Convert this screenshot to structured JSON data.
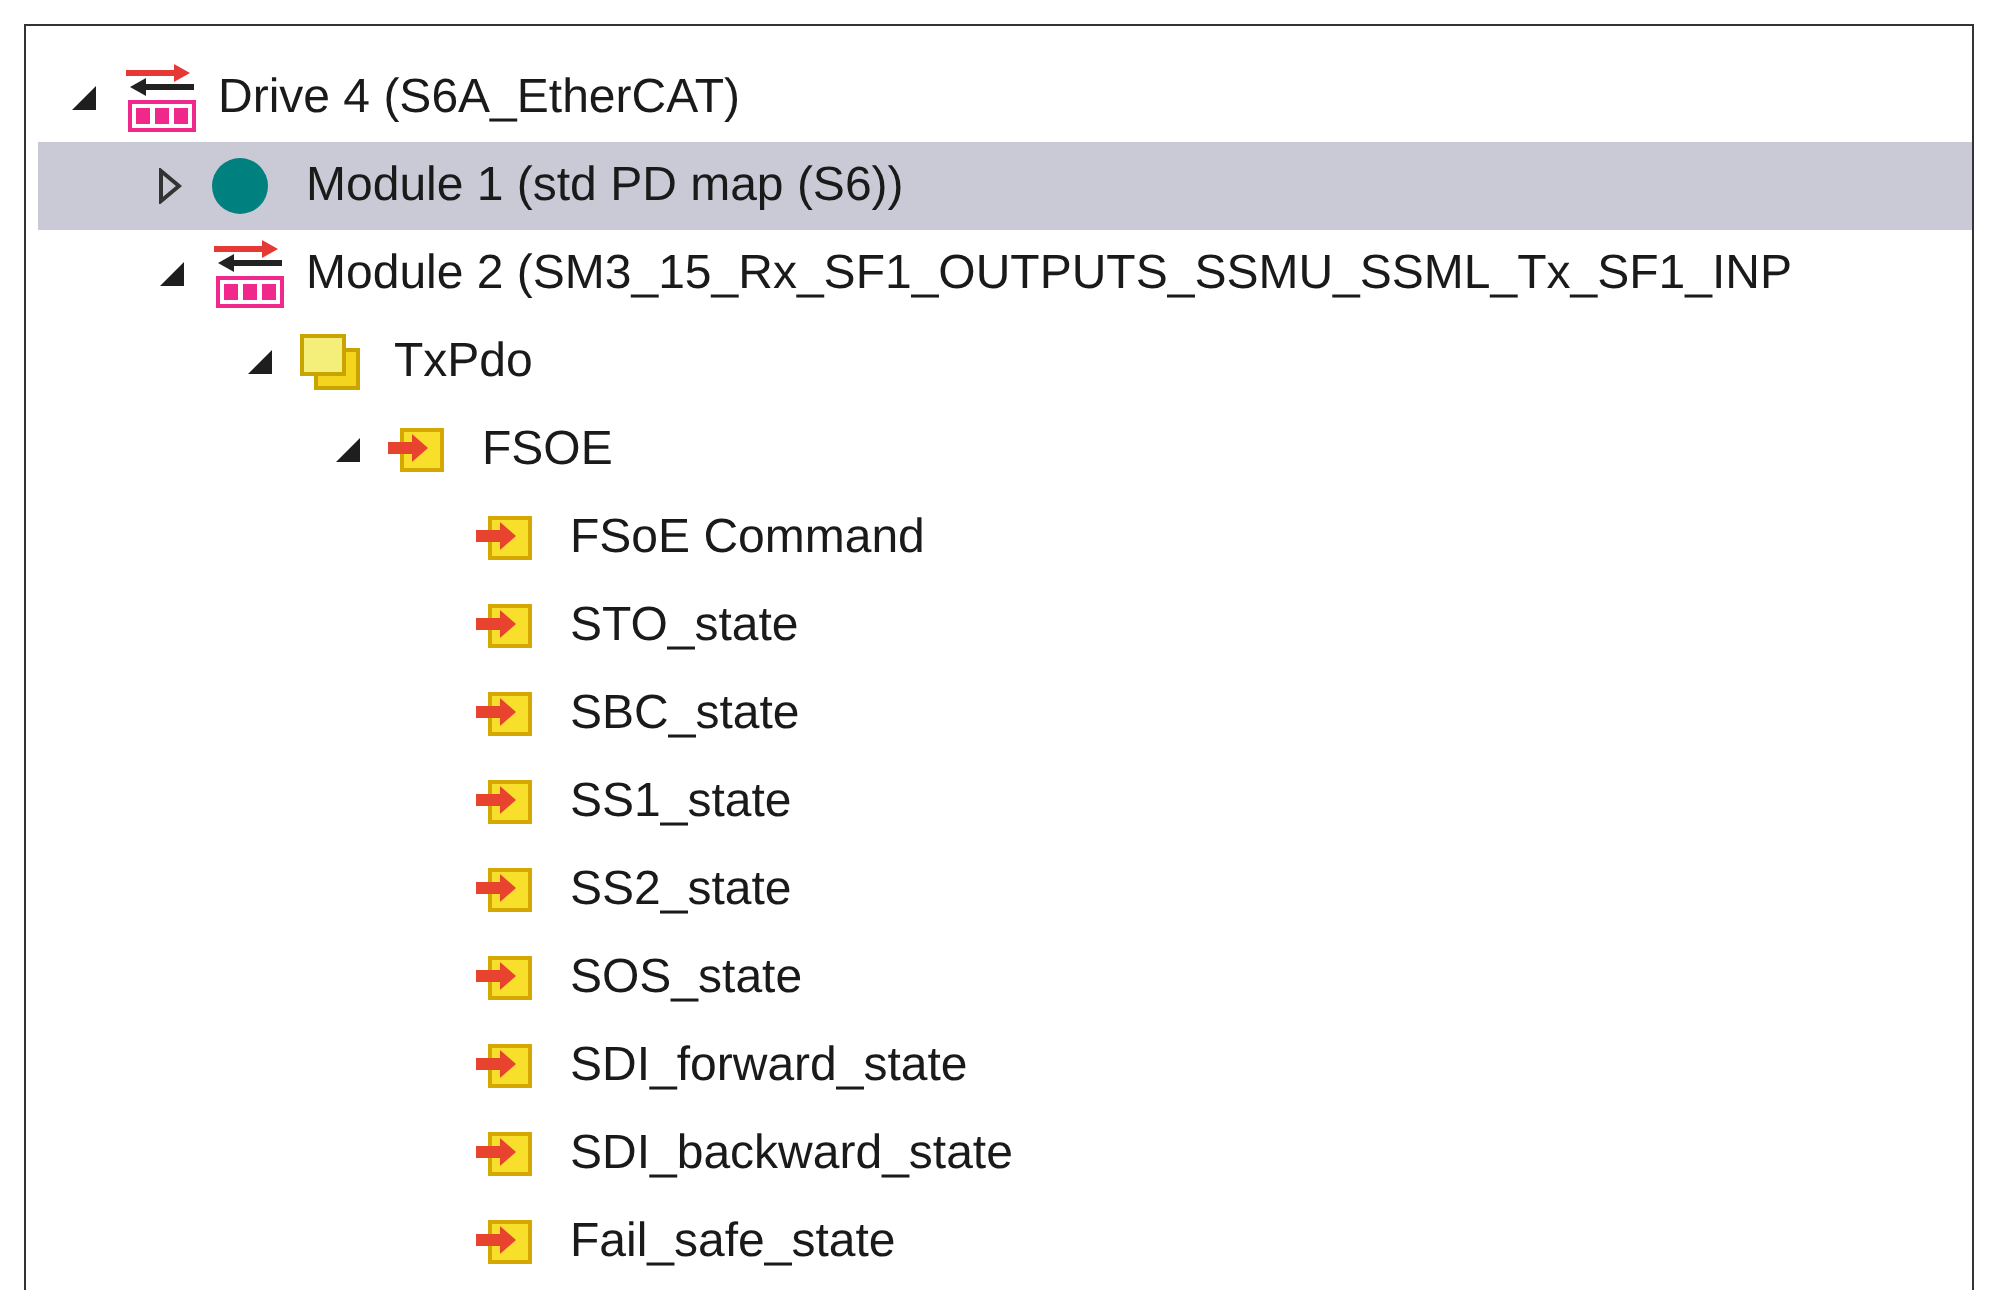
{
  "tree": [
    {
      "label": "Drive 4 (S6A_EtherCAT)",
      "kind": "device",
      "expanded": true,
      "selected": false,
      "children": [
        {
          "label": "Module 1 (std PD map (S6))",
          "kind": "module",
          "expanded": false,
          "selected": true
        },
        {
          "label": "Module 2 (SM3_15_Rx_SF1_OUTPUTS_SSMU_SSML_Tx_SF1_INP",
          "kind": "device",
          "expanded": true,
          "selected": false,
          "children": [
            {
              "label": "TxPdo",
              "kind": "group",
              "expanded": true,
              "selected": false,
              "children": [
                {
                  "label": "FSOE",
                  "kind": "variable",
                  "expanded": true,
                  "selected": false,
                  "children": [
                    {
                      "label": "FSoE Command",
                      "kind": "variable",
                      "selected": false
                    },
                    {
                      "label": "STO_state",
                      "kind": "variable",
                      "selected": false
                    },
                    {
                      "label": "SBC_state",
                      "kind": "variable",
                      "selected": false
                    },
                    {
                      "label": "SS1_state",
                      "kind": "variable",
                      "selected": false
                    },
                    {
                      "label": "SS2_state",
                      "kind": "variable",
                      "selected": false
                    },
                    {
                      "label": "SOS_state",
                      "kind": "variable",
                      "selected": false
                    },
                    {
                      "label": "SDI_forward_state",
                      "kind": "variable",
                      "selected": false
                    },
                    {
                      "label": "SDI_backward_state",
                      "kind": "variable",
                      "selected": false
                    },
                    {
                      "label": "Fail_safe_state",
                      "kind": "variable",
                      "selected": false
                    }
                  ]
                }
              ]
            }
          ]
        }
      ]
    }
  ]
}
